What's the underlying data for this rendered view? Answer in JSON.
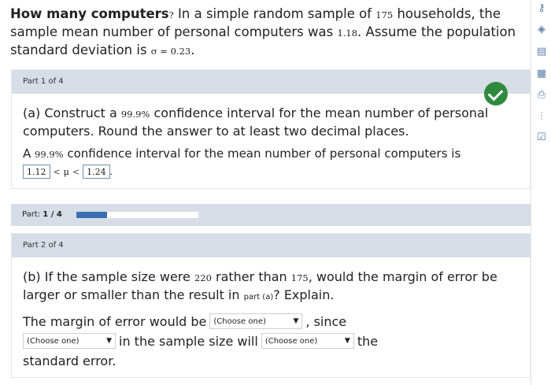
{
  "question": {
    "bold": "How many computers",
    "q_mark": "?",
    "t1": " In a simple random sample of ",
    "n": "175",
    "t2": " households, the sample mean number of personal computers was ",
    "mean": "1.18",
    "t3": ". Assume the population standard deviation is ",
    "sigma": "σ = 0.23",
    "t4": "."
  },
  "part1": {
    "header": "Part 1 of 4",
    "prompt_a": "(a) Construct a ",
    "conf": "99.9%",
    "prompt_b": " confidence interval for the mean number of personal computers. Round the answer to at least two decimal places.",
    "stmt_a": "A ",
    "stmt_conf": "99.9%",
    "stmt_b": " confidence interval for the mean number of personal computers is",
    "lower": "1.12",
    "lt1": "<",
    "mu": "μ",
    "lt2": "<",
    "upper": "1.24",
    "end": "."
  },
  "progress": {
    "label": "Part: ",
    "value": "1 / 4",
    "fraction": 0.25
  },
  "part2": {
    "header": "Part 2 of 4",
    "prompt_a": "(b) If the sample size were ",
    "new_n": "220",
    "prompt_b": " rather than ",
    "old_n": "175",
    "prompt_c": ", would the margin of error be larger or smaller than the result in ",
    "part_ref": "part (a)",
    "prompt_d": "? Explain.",
    "r1_a": "The margin of error would be",
    "select1": "(Choose one)",
    "r1_b": ", since",
    "select2": "(Choose one)",
    "r2_a": "in the sample size will",
    "select3": "(Choose one)",
    "r2_b": "the",
    "r3": "standard error."
  },
  "sidebar": {
    "icons": [
      "key-icon",
      "compass-icon",
      "notes-icon",
      "calculator-icon",
      "print-icon",
      "chart-icon",
      "checklist-icon"
    ]
  },
  "colors": {
    "check": "#2e8b3e",
    "progress_fill": "#3a6eb0",
    "panel_header": "#d6dde6"
  }
}
